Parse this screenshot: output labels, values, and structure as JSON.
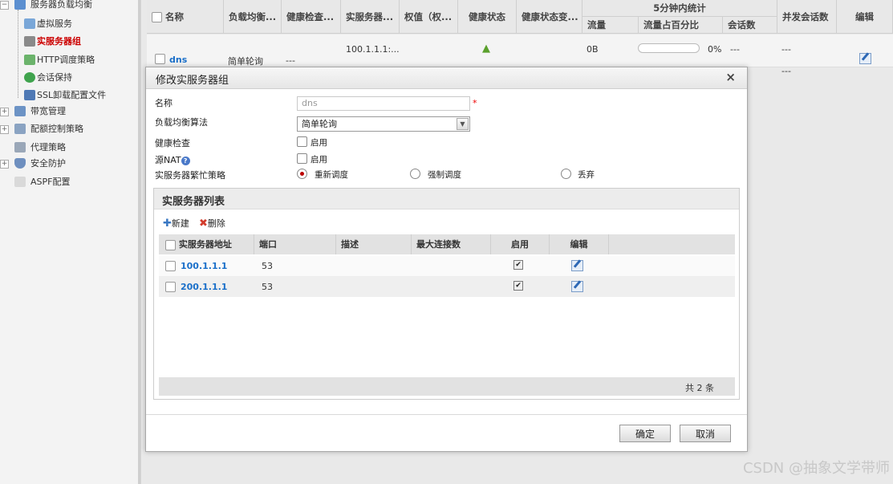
{
  "sidebar": {
    "items": [
      {
        "label": "服务器负载均衡",
        "expand": "−"
      },
      {
        "label": "虚拟服务"
      },
      {
        "label": "实服务器组"
      },
      {
        "label": "HTTP调度策略"
      },
      {
        "label": "会话保持"
      },
      {
        "label": "SSL卸载配置文件"
      },
      {
        "label": "带宽管理",
        "expand": "+"
      },
      {
        "label": "配额控制策略",
        "expand": "+"
      },
      {
        "label": "代理策略"
      },
      {
        "label": "安全防护",
        "expand": "+"
      },
      {
        "label": "ASPF配置"
      }
    ]
  },
  "grid": {
    "headers": [
      "名称",
      "负载均衡...",
      "健康检查...",
      "实服务器...",
      "权值（权...",
      "健康状态",
      "健康状态变...",
      "5分钟内统计",
      "流量",
      "流量占百分比",
      "会话数",
      "并发会话数",
      "编辑"
    ],
    "row": {
      "name": "dns",
      "algo": "简单轮询",
      "health": "---",
      "servers": "100.1.1.1:...",
      "traffic": "0B",
      "percent": "0%",
      "sessions": "---",
      "concurrent": "---",
      "concurrent2": "---",
      "percent_value": 0
    }
  },
  "modal": {
    "title": "修改实服务器组",
    "close": "×",
    "fields": {
      "name_label": "名称",
      "name_placeholder": "dns",
      "required_mark": "*",
      "algo_label": "负载均衡算法",
      "algo_value": "简单轮询",
      "health_label": "健康检查",
      "health_opt": "启用",
      "snat_label": "源NAT",
      "snat_opt": "启用",
      "help": "?",
      "busy_label": "实服务器繁忙策略",
      "busy_options": [
        "重新调度",
        "强制调度",
        "丢弃"
      ],
      "busy_selected": "重新调度"
    },
    "panel": {
      "title": "实服务器列表",
      "new_label": "新建",
      "delete_label": "删除",
      "columns": [
        "实服务器地址",
        "端口",
        "描述",
        "最大连接数",
        "启用",
        "编辑"
      ],
      "rows": [
        {
          "address": "100.1.1.1",
          "port": "53",
          "desc": "",
          "maxconn": "",
          "enabled": true
        },
        {
          "address": "200.1.1.1",
          "port": "53",
          "desc": "",
          "maxconn": "",
          "enabled": true
        }
      ],
      "total": "共 2 条"
    },
    "ok": "确定",
    "cancel": "取消"
  },
  "watermark": "CSDN @抽象文学带师"
}
